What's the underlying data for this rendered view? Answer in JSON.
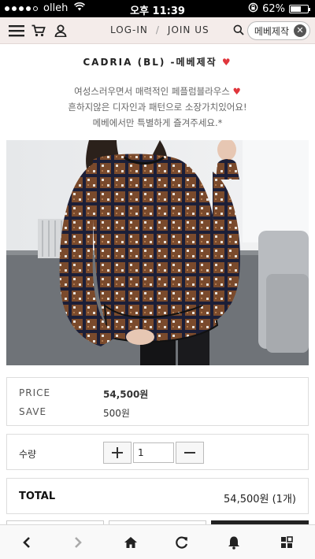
{
  "status": {
    "carrier": "olleh",
    "time": "오후 11:39",
    "battery": "62%",
    "battery_level": 0.62
  },
  "nav": {
    "login": "LOG-IN",
    "separator": "/",
    "join": "JOIN US",
    "search_value": "메베제작"
  },
  "product": {
    "title": "CADRIA (BL) -메베제작",
    "heart": "♥",
    "desc_line1": "여성스러우면서 매력적인 페플럼블라우스",
    "desc_line2": "흔하지않은 디자인과 패턴으로 소장가치있어요!",
    "desc_line3": "메베에서만 특별하게 즐겨주세요.*"
  },
  "price": {
    "price_label": "PRICE",
    "price_value": "54,500원",
    "save_label": "SAVE",
    "save_value": "500원"
  },
  "quantity": {
    "label": "수량",
    "value": "1"
  },
  "total": {
    "label": "TOTAL",
    "value": "54,500원 (1개)"
  },
  "icons": {
    "menu": "hamburger-icon",
    "cart": "cart-icon",
    "user": "user-icon",
    "search": "search-icon",
    "back": "chevron-left-icon",
    "forward": "chevron-right-icon",
    "home": "home-icon",
    "refresh": "refresh-icon",
    "bell": "bell-icon",
    "tabs": "tabs-icon"
  },
  "colors": {
    "nav_bg": "#f4ecea",
    "heart": "#e0363c",
    "status_bg": "#000000"
  }
}
